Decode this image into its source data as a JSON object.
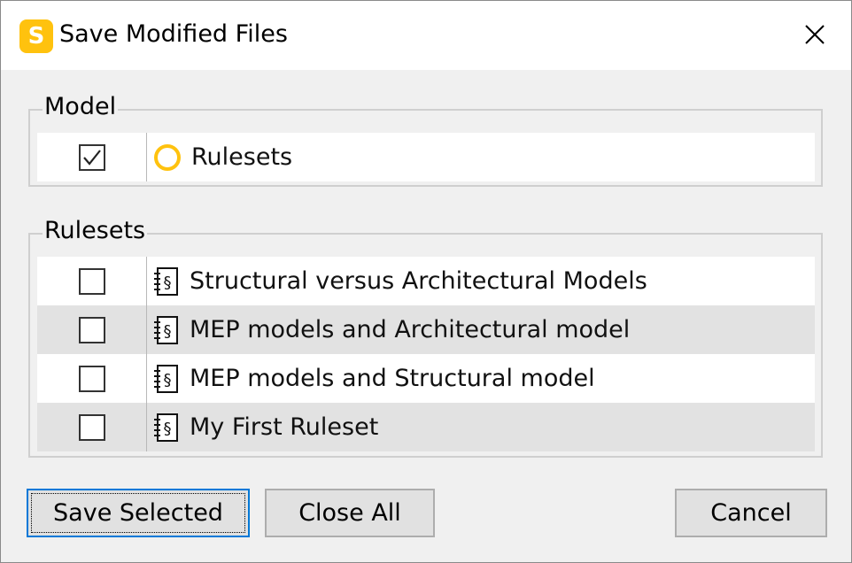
{
  "window": {
    "title": "Save Modified Files",
    "app_icon_letter": "S",
    "accent_color": "#ffc20e"
  },
  "model_group": {
    "legend": "Model",
    "items": [
      {
        "label": "Rulesets",
        "checked": true,
        "icon": "circle-icon"
      }
    ]
  },
  "rulesets_group": {
    "legend": "Rulesets",
    "items": [
      {
        "label": "Structural versus Architectural Models",
        "checked": false,
        "icon": "ruleset-icon"
      },
      {
        "label": "MEP models and Architectural model",
        "checked": false,
        "icon": "ruleset-icon"
      },
      {
        "label": "MEP models and Structural model",
        "checked": false,
        "icon": "ruleset-icon"
      },
      {
        "label": "My First Ruleset",
        "checked": false,
        "icon": "ruleset-icon"
      }
    ]
  },
  "buttons": {
    "save_selected": "Save Selected",
    "close_all": "Close All",
    "cancel": "Cancel"
  }
}
